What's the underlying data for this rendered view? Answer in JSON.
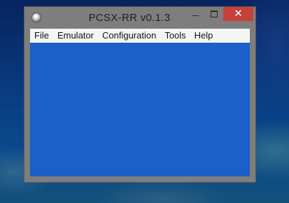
{
  "window": {
    "title": "PCSX-RR v0.1.3",
    "icon": "cd-disc-icon",
    "controls": {
      "minimize": "minimize",
      "maximize": "maximize",
      "close": "✕"
    }
  },
  "menu": {
    "items": [
      {
        "label": "File"
      },
      {
        "label": "Emulator"
      },
      {
        "label": "Configuration"
      },
      {
        "label": "Tools"
      },
      {
        "label": "Help"
      }
    ]
  },
  "colors": {
    "client_area": "#1b5fc8",
    "frame": "#7e7e7e",
    "close_button": "#c8403a",
    "menubar": "#f5f5f5"
  }
}
